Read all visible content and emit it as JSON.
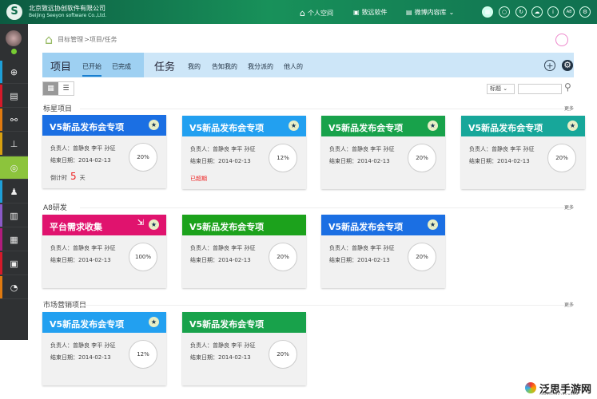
{
  "header": {
    "company_cn": "北京致远协创软件有限公司",
    "company_en": "Beijing Seeyon software Co.,Ltd.",
    "nav": [
      {
        "label": "个人空间",
        "icon": "home-icon"
      },
      {
        "label": "致远软件",
        "icon": "building-icon"
      },
      {
        "label": "微博内容库",
        "icon": "library-icon"
      }
    ],
    "icons": [
      "grid-icon",
      "search-icon",
      "refresh-icon",
      "cloud-icon",
      "info-icon",
      "a8-icon",
      "settings-icon"
    ],
    "a8": "A8"
  },
  "breadcrumb": {
    "root": "目标管理",
    "path": ">项目/任务"
  },
  "tabs": {
    "project_title": "项目",
    "project_tabs": [
      "已开始",
      "已完成"
    ],
    "task_title": "任务",
    "task_tabs": [
      "我的",
      "告知我的",
      "我分派的",
      "他人的"
    ]
  },
  "filter": {
    "select": "标题",
    "search_placeholder": ""
  },
  "labels": {
    "owner": "负责人：",
    "end": "结束日期：",
    "more": "更多",
    "countdown": "倒计时",
    "days": "天"
  },
  "sections": [
    {
      "title": "标星项目",
      "cards": [
        {
          "title": "V5新品发布会专项",
          "color": "#1b6fe3",
          "owners": "曾静良 李平 孙征",
          "end": "2014-02-13",
          "pct": "20%",
          "countdown": "5",
          "star": true
        },
        {
          "title": "V5新品发布会专项",
          "color": "#22a0f0",
          "owners": "曾静良 李平 孙征",
          "end": "2014-02-13",
          "pct": "12%",
          "status": "已超期",
          "star": true
        },
        {
          "title": "V5新品发布会专项",
          "color": "#18a24b",
          "owners": "曾静良 李平 孙征",
          "end": "2014-02-13",
          "pct": "20%",
          "star": true
        },
        {
          "title": "V5新品发布会专项",
          "color": "#17a79a",
          "owners": "曾静良 李平 孙征",
          "end": "2014-02-13",
          "pct": "20%",
          "star": true
        }
      ]
    },
    {
      "title": "A8研发",
      "cards": [
        {
          "title": "平台需求收集",
          "color": "#e0136e",
          "owners": "曾静良 李平 孙征",
          "end": "2014-02-13",
          "pct": "100%",
          "star": true,
          "export": true
        },
        {
          "title": "V5新品发布会专项",
          "color": "#1ca21c",
          "owners": "曾静良 李平 孙征",
          "end": "2014-02-13",
          "pct": "20%"
        },
        {
          "title": "V5新品发布会专项",
          "color": "#1b6fe3",
          "owners": "曾静良 李平 孙征",
          "end": "2014-02-13",
          "pct": "20%",
          "star": true
        }
      ]
    },
    {
      "title": "市场营销项目",
      "cards": [
        {
          "title": "V5新品发布会专项",
          "color": "#22a0f0",
          "owners": "曾静良 李平 孙征",
          "end": "2014-02-13",
          "pct": "12%",
          "star": true
        },
        {
          "title": "V5新品发布会专项",
          "color": "#18a24b",
          "owners": "曾静良 李平 孙征",
          "end": "2014-02-13",
          "pct": "20%"
        }
      ]
    }
  ],
  "sidebar": [
    {
      "icon": "add-icon",
      "color": "#1e9fd8"
    },
    {
      "icon": "report-icon",
      "color": "#d51a2a"
    },
    {
      "icon": "share-icon",
      "color": "#e07a10"
    },
    {
      "icon": "stamp-icon",
      "color": "#d8a010"
    },
    {
      "icon": "target-icon",
      "color": "#8cc43c",
      "active": true
    },
    {
      "icon": "person-icon",
      "color": "#1e9fd8"
    },
    {
      "icon": "book-icon",
      "color": "#8a5ac8"
    },
    {
      "icon": "calendar-icon",
      "color": "#b01c7c"
    },
    {
      "icon": "briefcase-icon",
      "color": "#d51a2a"
    },
    {
      "icon": "gauge-icon",
      "color": "#e07a10"
    }
  ],
  "watermark": {
    "cn": "泛思手游网",
    "en": "FANSISHOUYOUWANG"
  }
}
